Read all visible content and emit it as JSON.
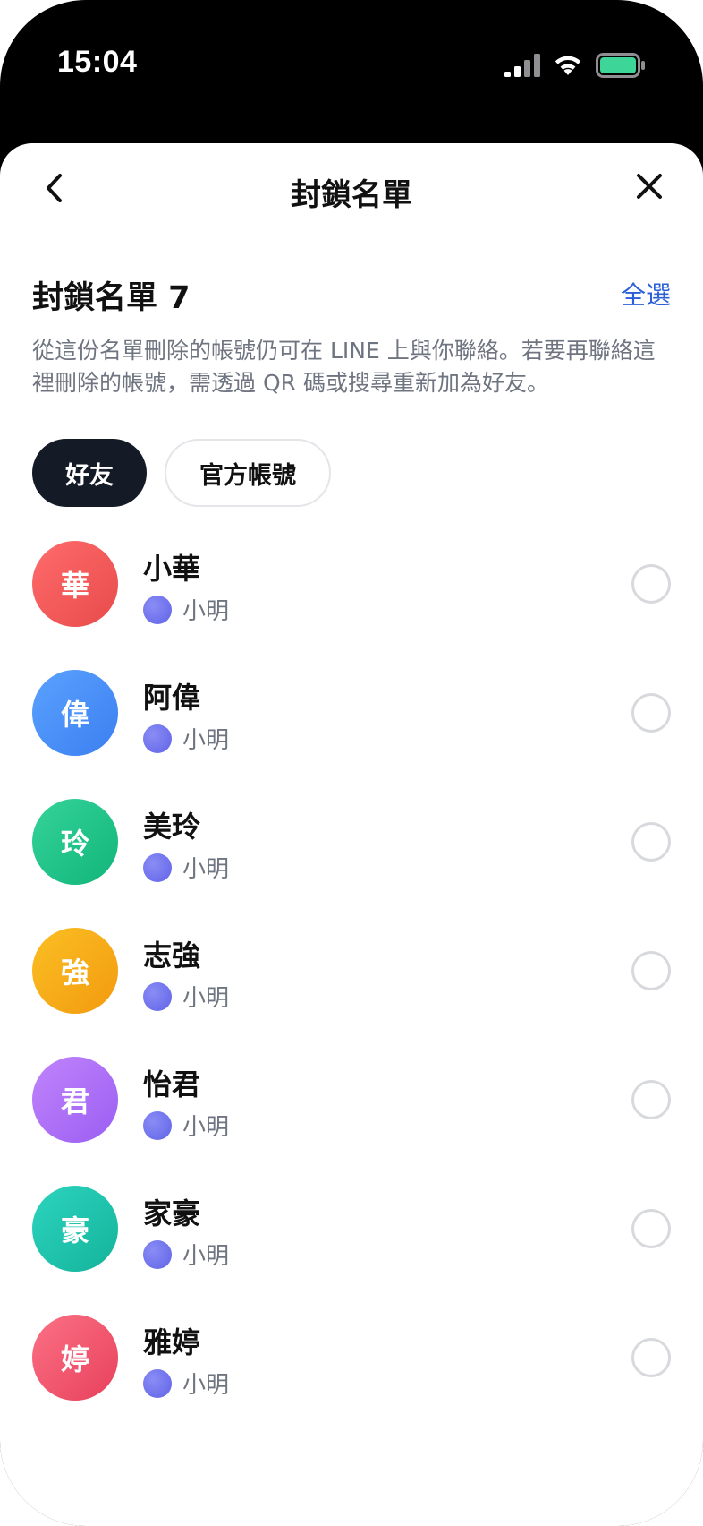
{
  "status_bar": {
    "time": "15:04",
    "icons": [
      "signal-icon",
      "wifi-icon",
      "battery-icon"
    ],
    "battery_color": "#3ed598"
  },
  "nav": {
    "title": "封鎖名單",
    "back_icon": "chevron-left-icon",
    "close_icon": "close-icon"
  },
  "section": {
    "title": "封鎖名單 7",
    "select_all": "全選",
    "description": "從這份名單刪除的帳號仍可在 LINE 上與你聯絡。若要再聯絡這裡刪除的帳號，需透過 QR 碼或搜尋重新加為好友。"
  },
  "tabs": [
    {
      "label": "好友",
      "active": true
    },
    {
      "label": "官方帳號",
      "active": false
    }
  ],
  "accent_color": "#2a5fd8",
  "contacts": [
    {
      "initial": "華",
      "name": "小華",
      "sub": "小明",
      "color_from": "#ff6b6b",
      "color_to": "#e84b4b",
      "selected": false
    },
    {
      "initial": "偉",
      "name": "阿偉",
      "sub": "小明",
      "color_from": "#5aa2ff",
      "color_to": "#3b7ff0",
      "selected": false
    },
    {
      "initial": "玲",
      "name": "美玲",
      "sub": "小明",
      "color_from": "#34d399",
      "color_to": "#12b57a",
      "selected": false
    },
    {
      "initial": "強",
      "name": "志強",
      "sub": "小明",
      "color_from": "#fbbf24",
      "color_to": "#f29a0e",
      "selected": false
    },
    {
      "initial": "君",
      "name": "怡君",
      "sub": "小明",
      "color_from": "#c084fc",
      "color_to": "#9b5ef2",
      "selected": false
    },
    {
      "initial": "豪",
      "name": "家豪",
      "sub": "小明",
      "color_from": "#2dd4bf",
      "color_to": "#14b39a",
      "selected": false
    },
    {
      "initial": "婷",
      "name": "雅婷",
      "sub": "小明",
      "color_from": "#fb7185",
      "color_to": "#e8415c",
      "selected": false
    }
  ]
}
